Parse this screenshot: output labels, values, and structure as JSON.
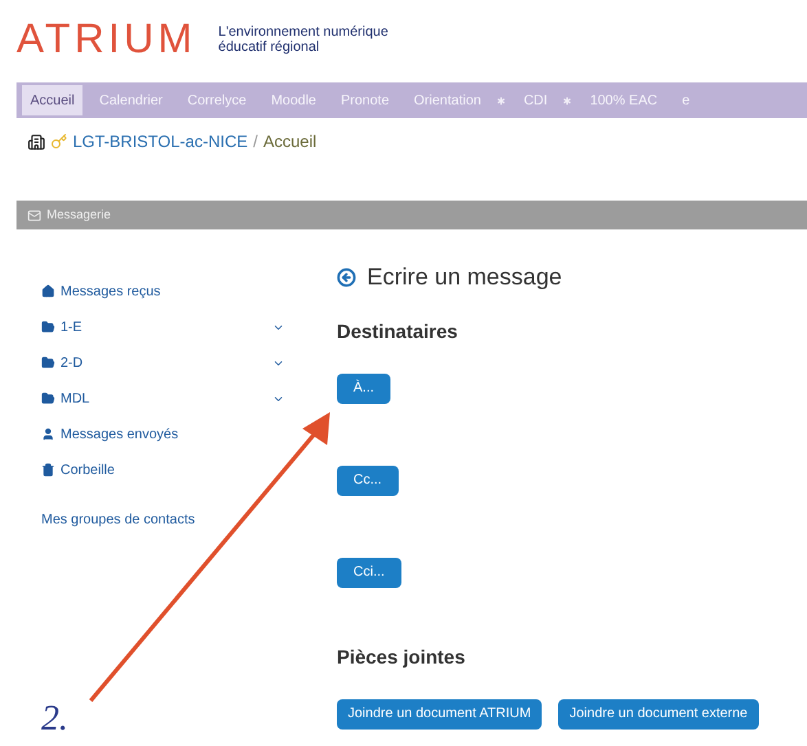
{
  "header": {
    "logo": "ATRIUM",
    "tagline": "L'environnement numérique éducatif régional"
  },
  "nav": [
    {
      "label": "Accueil",
      "selected": true,
      "star": false
    },
    {
      "label": "Calendrier",
      "selected": false,
      "star": false
    },
    {
      "label": "Correlyce",
      "selected": false,
      "star": false
    },
    {
      "label": "Moodle",
      "selected": false,
      "star": false
    },
    {
      "label": "Pronote",
      "selected": false,
      "star": false
    },
    {
      "label": "Orientation",
      "selected": false,
      "star": true
    },
    {
      "label": "CDI",
      "selected": false,
      "star": true
    },
    {
      "label": "100% EAC",
      "selected": false,
      "star": false
    },
    {
      "label": "e",
      "selected": false,
      "star": false
    }
  ],
  "breadcrumb": {
    "school": "LGT-BRISTOL-ac-NICE",
    "separator": "/",
    "page": "Accueil"
  },
  "panel_title": "Messagerie",
  "sidebar": {
    "items": [
      {
        "label": "Messages reçus",
        "kind": "home",
        "dropdown": false
      },
      {
        "label": "1-E",
        "kind": "folder",
        "dropdown": true
      },
      {
        "label": "2-D",
        "kind": "folder",
        "dropdown": true
      },
      {
        "label": "MDL",
        "kind": "folder",
        "dropdown": true
      },
      {
        "label": "Messages envoyés",
        "kind": "user",
        "dropdown": false
      },
      {
        "label": "Corbeille",
        "kind": "trash",
        "dropdown": false
      }
    ],
    "groups_link": "Mes groupes de contacts"
  },
  "main": {
    "title": "Ecrire un message",
    "recipients_heading": "Destinataires",
    "recipient_buttons": [
      "À...",
      "Cc...",
      "Cci..."
    ],
    "attachments_heading": "Pièces jointes",
    "attachment_buttons": [
      "Joindre un document ATRIUM",
      "Joindre un document externe"
    ]
  },
  "annotation": {
    "label": "2."
  }
}
